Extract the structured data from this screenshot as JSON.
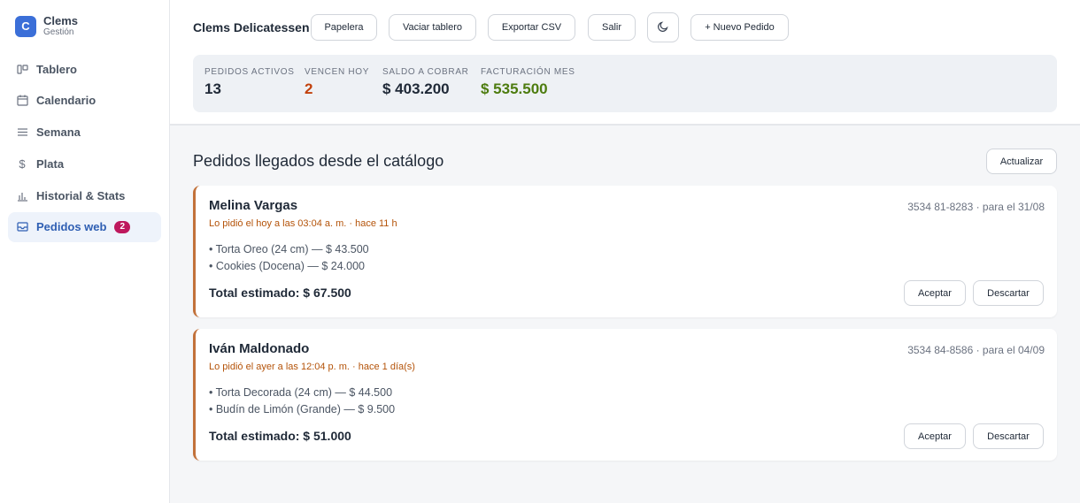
{
  "brand": {
    "logo_letter": "C",
    "name": "Clems",
    "subtitle": "Gestión"
  },
  "sidebar": {
    "items": [
      {
        "label": "Tablero",
        "icon": "board-icon"
      },
      {
        "label": "Calendario",
        "icon": "calendar-icon"
      },
      {
        "label": "Semana",
        "icon": "list-icon"
      },
      {
        "label": "Plata",
        "icon": "dollar-icon"
      },
      {
        "label": "Historial & Stats",
        "icon": "bar-chart-icon"
      },
      {
        "label": "Pedidos web",
        "icon": "inbox-icon",
        "badge": "2",
        "active": true
      }
    ]
  },
  "header": {
    "title": "Clems Delicatessen",
    "buttons": {
      "trash": "Papelera",
      "clear": "Vaciar tablero",
      "export": "Exportar CSV",
      "logout": "Salir",
      "theme_icon": "moon-icon",
      "new_order": "+ Nuevo Pedido"
    }
  },
  "stats": {
    "active": {
      "label": "Pedidos activos",
      "value": "13"
    },
    "due": {
      "label": "Vencen hoy",
      "value": "2"
    },
    "balance": {
      "label": "Saldo a cobrar",
      "value": "$ 403.200"
    },
    "billing": {
      "label": "Facturación mes",
      "value": "$ 535.500"
    }
  },
  "main": {
    "title": "Pedidos llegados desde el catálogo",
    "refresh_label": "Actualizar"
  },
  "orders": [
    {
      "name": "Melina Vargas",
      "meta": "Lo pidió el hoy a las 03:04 a. m. · hace 11 h",
      "contact": "3534 81-8283 · para el 31/08",
      "items": [
        "• Torta Oreo (24 cm) — $ 43.500",
        "• Cookies (Docena) — $ 24.000"
      ],
      "total": "Total estimado: $ 67.500",
      "accept": "Aceptar",
      "discard": "Descartar"
    },
    {
      "name": "Iván Maldonado",
      "meta": "Lo pidió el ayer a las 12:04 p. m. · hace 1 día(s)",
      "contact": "3534 84-8586 · para el 04/09",
      "items": [
        "• Torta Decorada (24 cm) — $ 44.500",
        "• Budín de Limón (Grande) — $ 9.500"
      ],
      "total": "Total estimado: $ 51.000",
      "accept": "Aceptar",
      "discard": "Descartar"
    }
  ],
  "colors": {
    "accent": "#3b6fd8",
    "active_nav_bg": "#eef3fb",
    "badge": "#be185d",
    "due_value": "#c2410c",
    "billing_value": "#4d7c0f",
    "card_border": "#c2713a",
    "meta_text": "#b45309"
  }
}
